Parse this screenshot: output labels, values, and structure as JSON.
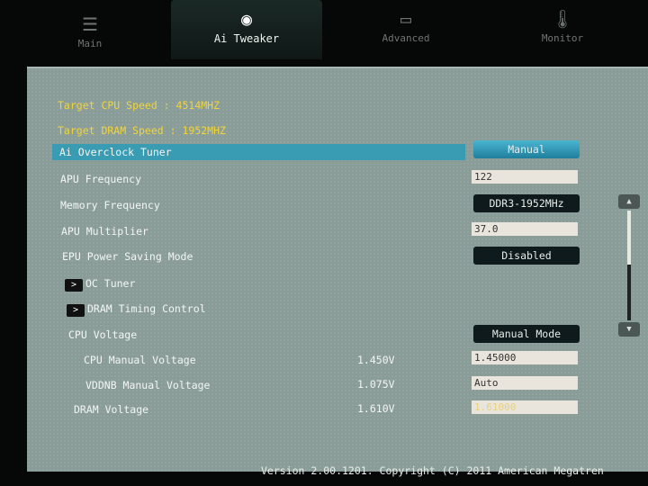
{
  "tabs": [
    {
      "label": "Main",
      "icon": "list-icon"
    },
    {
      "label": "Ai Tweaker",
      "icon": "tweaker-icon",
      "active": true
    },
    {
      "label": "Advanced",
      "icon": "advanced-info-icon"
    },
    {
      "label": "Monitor",
      "icon": "thermometer-icon"
    }
  ],
  "info": {
    "cpu_speed": "Target CPU Speed : 4514MHZ",
    "dram_speed": "Target DRAM Speed : 1952MHZ"
  },
  "settings": {
    "overclock_tuner": {
      "label": "Ai Overclock Tuner",
      "value": "Manual"
    },
    "apu_frequency": {
      "label": "APU Frequency",
      "value": "122"
    },
    "memory_frequency": {
      "label": "Memory Frequency",
      "value": "DDR3-1952MHz"
    },
    "apu_multiplier": {
      "label": "APU Multiplier",
      "value": "37.0"
    },
    "epu_power": {
      "label": "EPU Power Saving Mode",
      "value": "Disabled"
    },
    "oc_tuner": {
      "label": "OC Tuner"
    },
    "dram_timing": {
      "label": "DRAM Timing Control"
    },
    "cpu_voltage": {
      "label": "CPU Voltage",
      "value": "Manual Mode"
    },
    "cpu_manual_voltage": {
      "label": "CPU Manual Voltage",
      "current": "1.450V",
      "value": "1.45000"
    },
    "vddnb_voltage": {
      "label": "VDDNB Manual Voltage",
      "current": "1.075V",
      "value": "Auto"
    },
    "dram_voltage": {
      "label": "DRAM Voltage",
      "current": "1.610V",
      "value": "1.61000"
    }
  },
  "footer": "Version 2.00.1201. Copyright (C) 2011 American Megatren"
}
